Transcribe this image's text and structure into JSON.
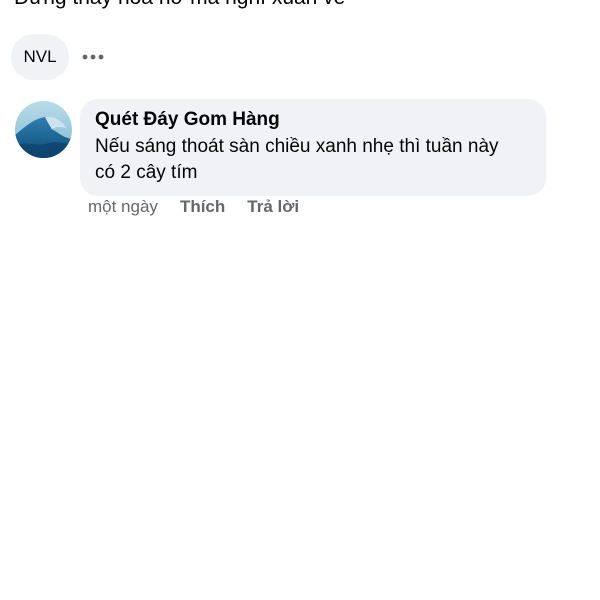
{
  "previous_comment": {
    "text": "Đừng thấy hoa nở mà nghĩ xuân về"
  },
  "reply_context": {
    "chip_label": "NVL",
    "more_icon": "more-horizontal-icon"
  },
  "comment": {
    "avatar_icon": "ocean-wave-avatar",
    "author": "Quét Đáy Gom Hàng",
    "text_line1": "Nếu sáng thoát sàn chiều xanh nhẹ thì tuần này",
    "text_line2": "có 2 cây tím",
    "time": "một ngày",
    "like_label": "Thích",
    "reply_label": "Trả lời"
  },
  "colors": {
    "bubble_bg": "#f0f2f5",
    "secondary_text": "#65676b",
    "primary_text": "#050505"
  }
}
